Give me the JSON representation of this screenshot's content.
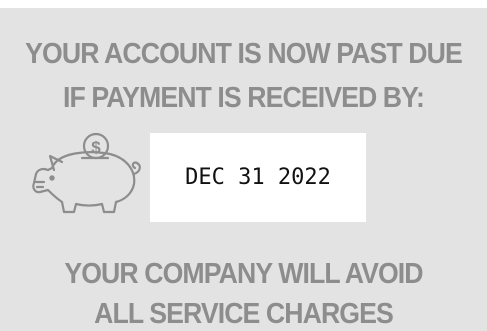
{
  "notice": {
    "line1": "YOUR ACCOUNT IS NOW PAST DUE",
    "line2": "IF PAYMENT IS RECEIVED BY:",
    "date": "DEC 31 2022",
    "line3": "YOUR COMPANY WILL AVOID",
    "line4": "ALL SERVICE CHARGES",
    "coin_symbol": "$"
  },
  "icons": {
    "piggy_bank": "piggy-bank-icon"
  },
  "colors": {
    "panel_background": "#e3e3e3",
    "headline_text": "#8d8d8d",
    "date_box": "#ffffff",
    "date_text": "#111111",
    "icon_stroke": "#8d8d8d"
  }
}
